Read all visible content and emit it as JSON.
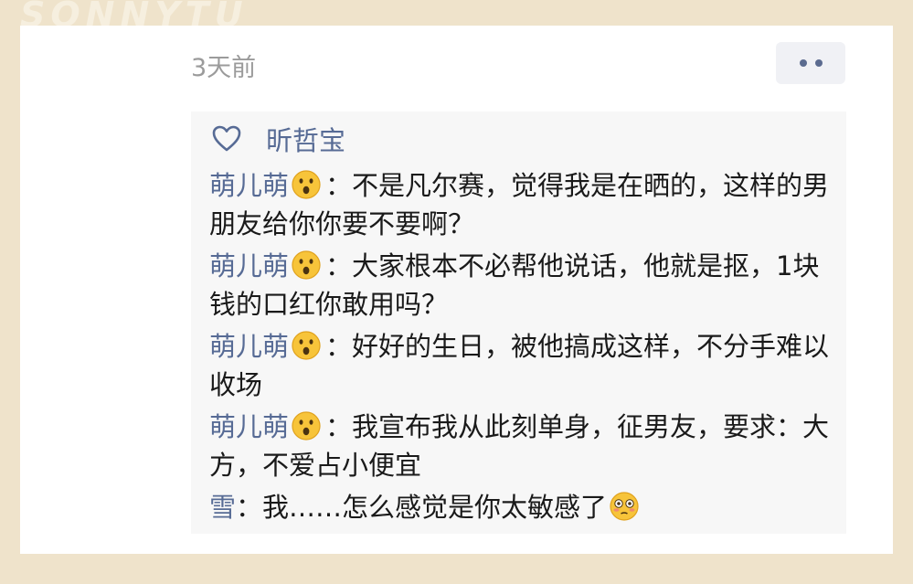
{
  "watermark": "SONNYTU",
  "post": {
    "timestamp": "3天前",
    "more_icon": "more-dots-icon"
  },
  "likes": {
    "icon": "heart-icon",
    "names": "昕哲宝"
  },
  "comments": [
    {
      "author": "萌儿萌",
      "emoji": "surprised-face",
      "separator": "：",
      "text": "不是凡尔赛，觉得我是在晒的，这样的男朋友给你你要不要啊？"
    },
    {
      "author": "萌儿萌",
      "emoji": "surprised-face",
      "separator": "：",
      "text": "大家根本不必帮他说话，他就是抠，1块钱的口红你敢用吗？"
    },
    {
      "author": "萌儿萌",
      "emoji": "surprised-face",
      "separator": "：",
      "text": "好好的生日，被他搞成这样，不分手难以收场"
    },
    {
      "author": "萌儿萌",
      "emoji": "surprised-face",
      "separator": "：",
      "text": "我宣布我从此刻单身，征男友，要求：大方，不爱占小便宜"
    },
    {
      "author": "雪",
      "emoji": "",
      "separator": "：",
      "text": "我……怎么感觉是你太敏感了",
      "trailing_emoji": "flushed-face"
    }
  ],
  "colors": {
    "background": "#efe3cb",
    "author_link": "#576b95",
    "comment_box": "#f7f7f7"
  }
}
